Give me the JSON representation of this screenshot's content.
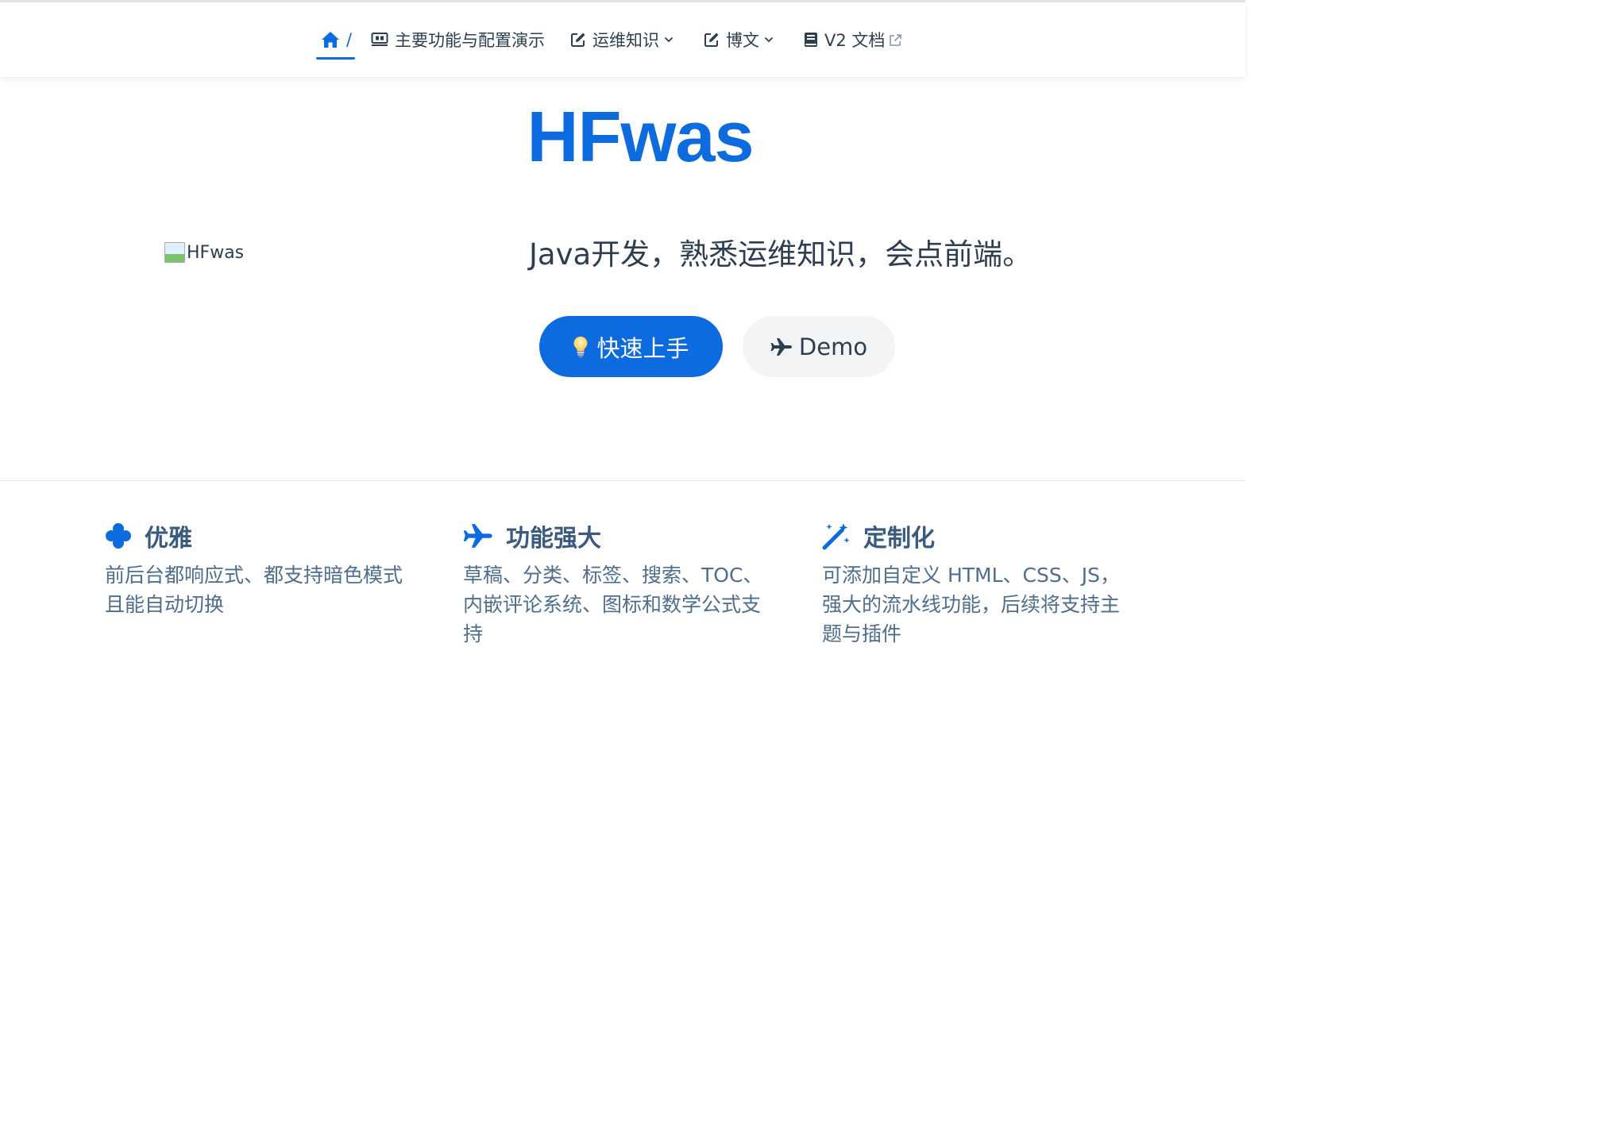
{
  "navbar": {
    "home_label": "/",
    "items": [
      {
        "label": "主要功能与配置演示",
        "icon": "slides-icon"
      },
      {
        "label": "运维知识",
        "icon": "edit-icon",
        "dropdown": true
      },
      {
        "label": "博文",
        "icon": "edit-icon",
        "dropdown": true
      },
      {
        "label": "V2 文档",
        "icon": "book-icon",
        "external": true
      }
    ]
  },
  "hero": {
    "title": "HFwas",
    "image_alt": "HFwas",
    "tagline": "Java开发，熟悉运维知识，会点前端。",
    "actions": [
      {
        "label": "快速上手",
        "icon": "lightbulb-icon",
        "style": "primary"
      },
      {
        "label": "Demo",
        "icon": "airplane-icon",
        "style": "secondary"
      }
    ]
  },
  "features": [
    {
      "title": "优雅",
      "icon": "clover-icon",
      "description": "前后台都响应式、都支持暗色模式且能自动切换"
    },
    {
      "title": "功能强大",
      "icon": "airplane-icon",
      "description": "草稿、分类、标签、搜索、TOC、内嵌评论系统、图标和数学公式支持"
    },
    {
      "title": "定制化",
      "icon": "magic-wand-icon",
      "description": "可添加自定义 HTML、CSS、JS，强大的流水线功能，后续将支持主题与插件"
    }
  ],
  "colors": {
    "accent": "#0d6be0",
    "text": "#2c3e50",
    "feature_title": "#3a5a80",
    "feature_text": "#4e6e8e",
    "secondary_button_bg": "#f3f4f5"
  }
}
